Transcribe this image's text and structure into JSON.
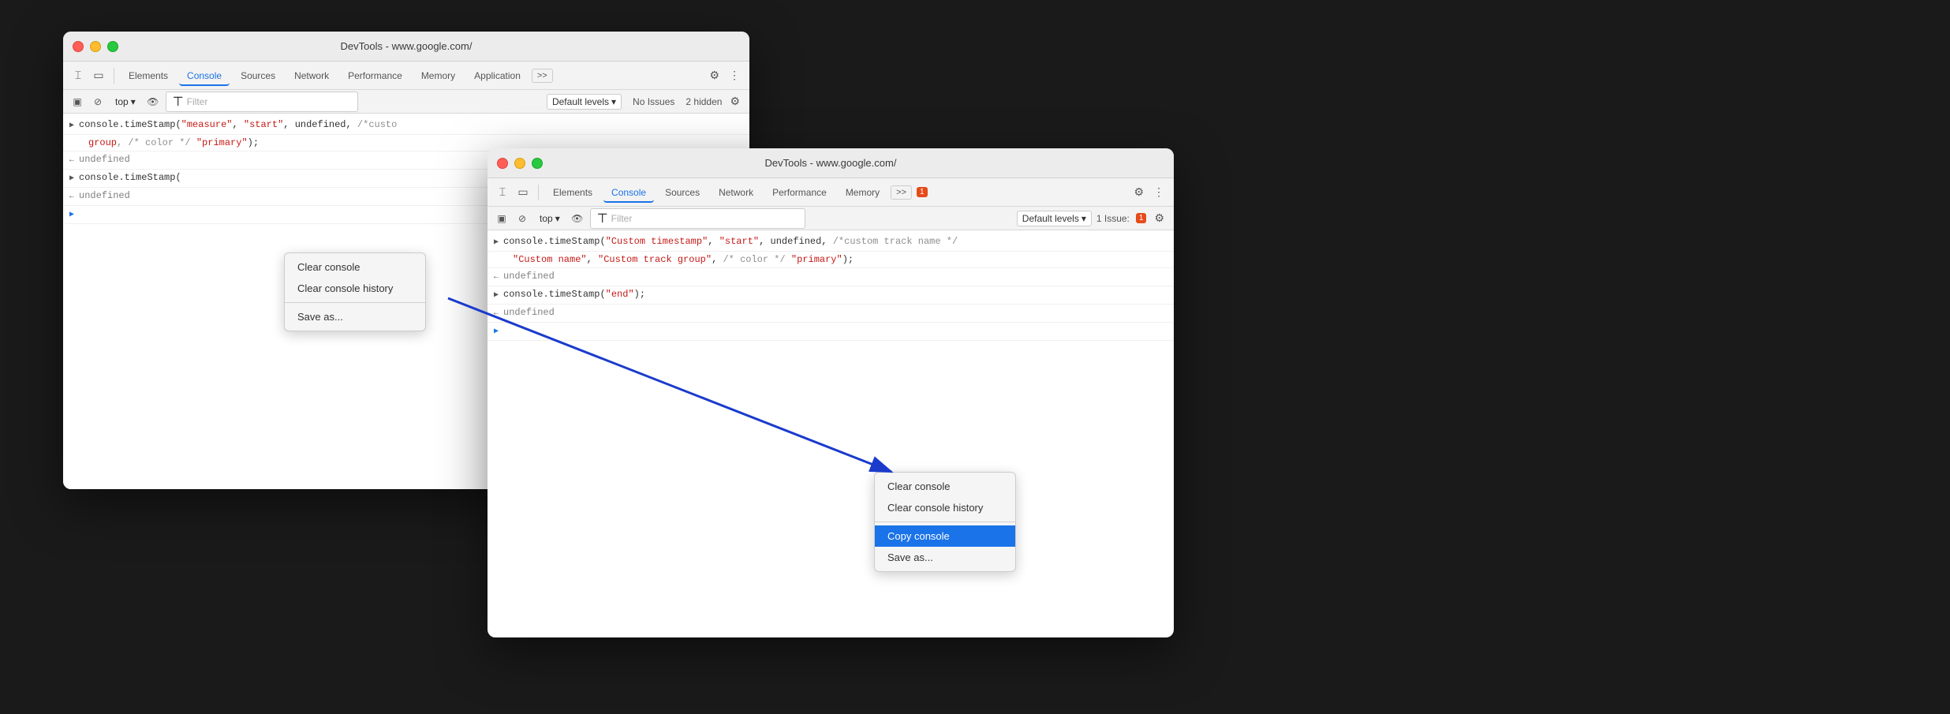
{
  "window1": {
    "title": "DevTools - www.google.com/",
    "tabs": [
      "Elements",
      "Console",
      "Sources",
      "Network",
      "Performance",
      "Memory",
      "Application"
    ],
    "active_tab": "Console",
    "console_toolbar": {
      "top_label": "top",
      "filter_placeholder": "Filter",
      "default_levels": "Default levels",
      "no_issues": "No Issues",
      "hidden": "2 hidden"
    },
    "console_lines": [
      {
        "type": "code",
        "prefix": ">",
        "text": "console.timeStamp(",
        "string_parts": [
          "\"measure\"",
          ", ",
          "\"start\"",
          ", undefined, /*cust"
        ],
        "continuation": "group\", /* color */ \"primary\");"
      },
      {
        "type": "result",
        "text": "undefined"
      },
      {
        "type": "code",
        "prefix": ">",
        "text": "console.timeStamp("
      },
      {
        "type": "result",
        "text": "undefined"
      },
      {
        "type": "prompt",
        "text": ""
      }
    ],
    "context_menu": {
      "items": [
        "Clear console",
        "Clear console history",
        "Save as..."
      ]
    }
  },
  "window2": {
    "title": "DevTools - www.google.com/",
    "tabs": [
      "Elements",
      "Console",
      "Sources",
      "Network",
      "Performance",
      "Memory"
    ],
    "active_tab": "Console",
    "badge": "1",
    "console_toolbar": {
      "top_label": "top",
      "filter_placeholder": "Filter",
      "default_levels": "Default levels",
      "issue_count": "1 Issue:",
      "issue_badge": "1"
    },
    "console_lines": [
      {
        "type": "code",
        "prefix": ">",
        "text_before": "console.timeStamp(",
        "string1": "\"Custom timestamp\"",
        "text_mid": ", ",
        "string2": "\"start\"",
        "text_end": ", undefined, /*custom track name */",
        "continuation": "\"Custom name\", \"Custom track group\", /* color */ \"primary\");"
      },
      {
        "type": "result",
        "text": "undefined"
      },
      {
        "type": "code",
        "prefix": ">",
        "text": "console.timeStamp(",
        "string1": "\"end\"",
        "text_end": ");"
      },
      {
        "type": "result",
        "text": "undefined"
      },
      {
        "type": "prompt",
        "text": ""
      }
    ],
    "context_menu": {
      "items": [
        "Clear console",
        "Clear console history",
        "Copy console",
        "Save as..."
      ],
      "active_item": "Copy console"
    }
  },
  "arrow": {
    "color": "#0000cc"
  }
}
